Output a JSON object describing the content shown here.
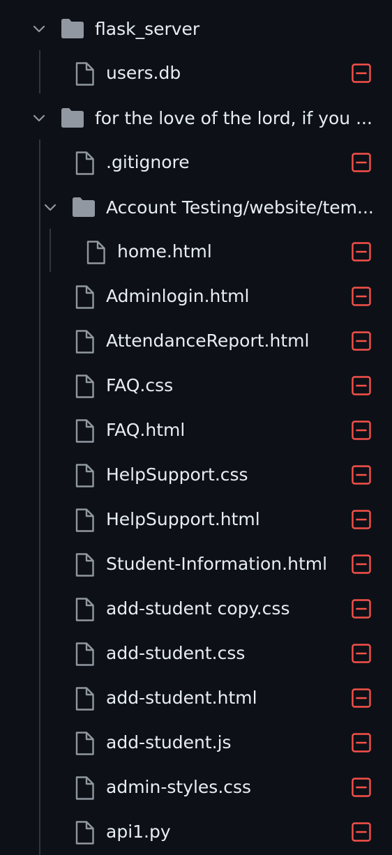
{
  "tree": [
    {
      "label": "flask_server",
      "type": "folder",
      "depth": 0
    },
    {
      "label": "users.db",
      "type": "file",
      "depth": 1
    },
    {
      "label": "for the love of the lord, if you ...",
      "type": "folder",
      "depth": 0
    },
    {
      "label": ".gitignore",
      "type": "file",
      "depth": 1
    },
    {
      "label": "Account Testing/website/tem...",
      "type": "folder",
      "depth": 1
    },
    {
      "label": "home.html",
      "type": "file",
      "depth": 2
    },
    {
      "label": "Adminlogin.html",
      "type": "file",
      "depth": 1
    },
    {
      "label": "AttendanceReport.html",
      "type": "file",
      "depth": 1
    },
    {
      "label": "FAQ.css",
      "type": "file",
      "depth": 1
    },
    {
      "label": "FAQ.html",
      "type": "file",
      "depth": 1
    },
    {
      "label": "HelpSupport.css",
      "type": "file",
      "depth": 1
    },
    {
      "label": "HelpSupport.html",
      "type": "file",
      "depth": 1
    },
    {
      "label": "Student-Information.html",
      "type": "file",
      "depth": 1
    },
    {
      "label": "add-student copy.css",
      "type": "file",
      "depth": 1
    },
    {
      "label": "add-student.css",
      "type": "file",
      "depth": 1
    },
    {
      "label": "add-student.html",
      "type": "file",
      "depth": 1
    },
    {
      "label": "add-student.js",
      "type": "file",
      "depth": 1
    },
    {
      "label": "admin-styles.css",
      "type": "file",
      "depth": 1
    },
    {
      "label": "api1.py",
      "type": "file",
      "depth": 1
    }
  ],
  "icons": {
    "folder": "folder-icon",
    "file": "file-icon",
    "expand": "chevron-down-icon",
    "remove": "remove-square-icon"
  },
  "colors": {
    "background": "#0d1117",
    "text": "#e6edf3",
    "icon": "#9198a1",
    "remove": "#f85149",
    "guide": "#30363d"
  }
}
